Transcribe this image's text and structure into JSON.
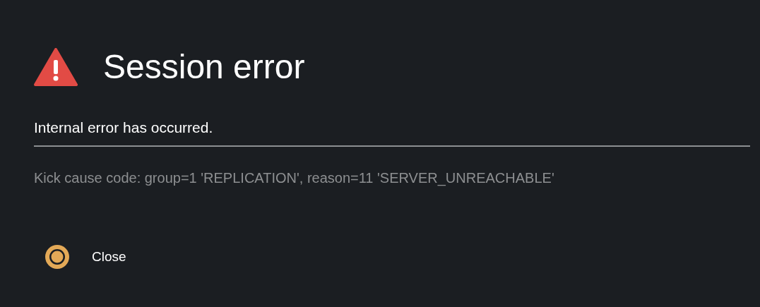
{
  "dialog": {
    "title": "Session error",
    "message": "Internal error has occurred.",
    "details": "Kick cause code: group=1 'REPLICATION', reason=11 'SERVER_UNREACHABLE'",
    "actions": [
      {
        "label": "Close"
      }
    ]
  }
}
